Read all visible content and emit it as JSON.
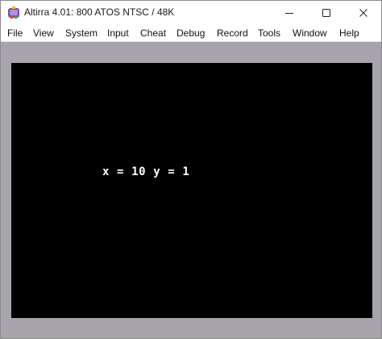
{
  "window": {
    "title": "Altirra 4.01: 800 ATOS NTSC / 48K",
    "icon": "altirra-app-icon",
    "controls": [
      "minimize-icon",
      "maximize-icon",
      "close-icon"
    ]
  },
  "menubar": {
    "items": [
      "File",
      "View",
      "System",
      "Input",
      "Cheat",
      "Debug",
      "Record",
      "Tools",
      "Window",
      "Help"
    ]
  },
  "emulator": {
    "screen_text": "x = 10 y = 1",
    "screen_color": "#000000",
    "border_color": "#a8a4ac",
    "text_color": "#ffffff"
  }
}
